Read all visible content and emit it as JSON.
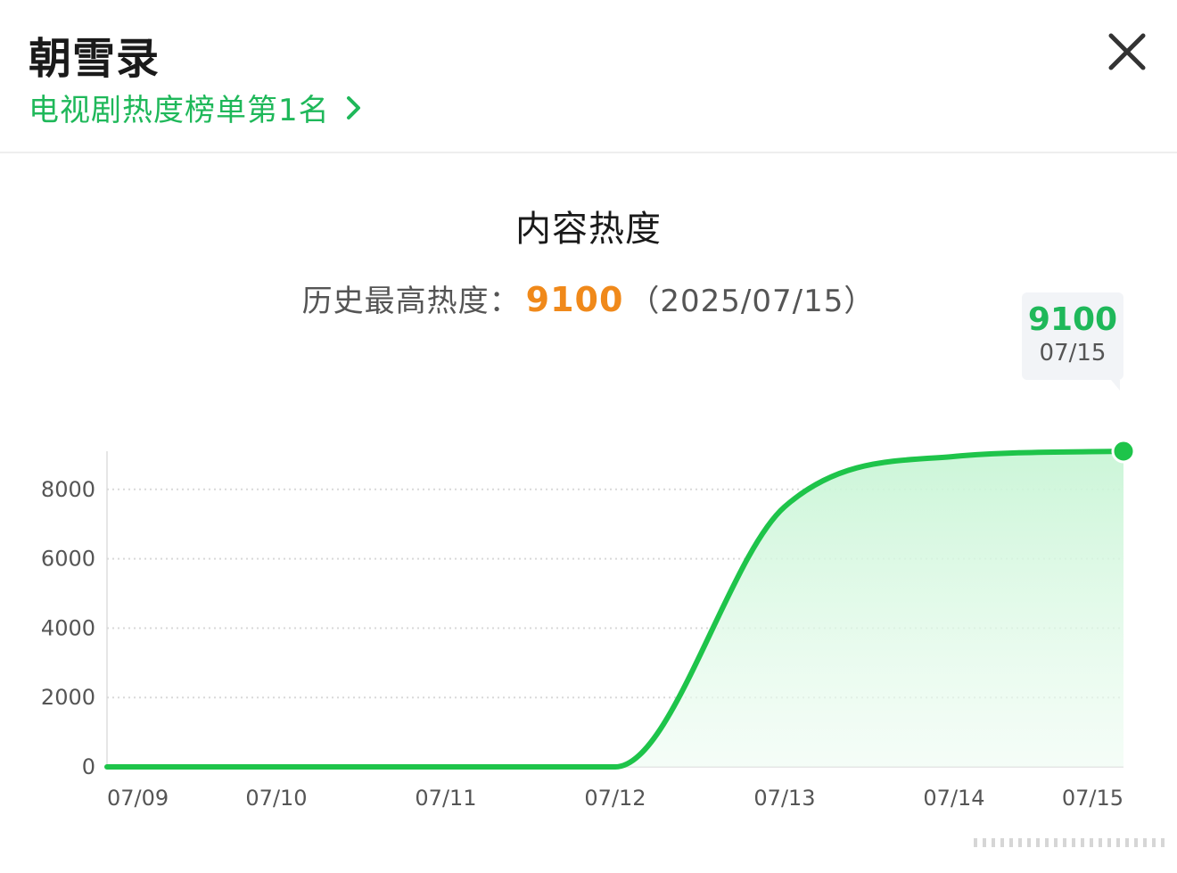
{
  "header": {
    "title": "朝雪录",
    "ranking_link": "电视剧热度榜单第1名"
  },
  "panel": {
    "heading": "内容热度",
    "peak_label": "历史最高热度：",
    "peak_value": "9100",
    "peak_date": "（2025/07/15）"
  },
  "tooltip": {
    "value": "9100",
    "date": "07/15"
  },
  "colors": {
    "accent": "#1fb85a",
    "peak": "#f0891a",
    "line": "#1ec44a"
  },
  "icons": {
    "close": "close-icon",
    "chevron": "chevron-right-icon"
  },
  "chart_data": {
    "type": "area",
    "title": "内容热度",
    "xlabel": "",
    "ylabel": "",
    "x": [
      "07/09",
      "07/10",
      "07/11",
      "07/12",
      "07/13",
      "07/14",
      "07/15"
    ],
    "y_ticks": [
      0,
      2000,
      4000,
      6000,
      8000
    ],
    "ylim": [
      0,
      9100
    ],
    "grid": true,
    "series": [
      {
        "values": [
          0,
          0,
          0,
          0,
          7500,
          8950,
          9100
        ]
      }
    ]
  }
}
